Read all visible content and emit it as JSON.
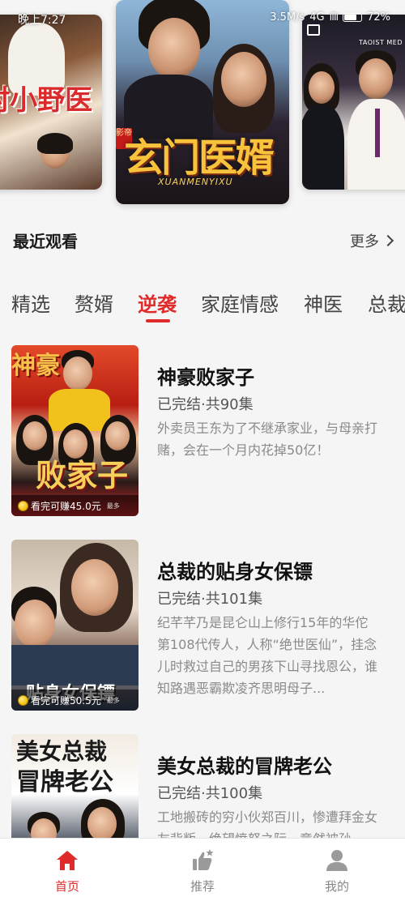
{
  "status_bar": {
    "time": "晚上7:27",
    "speed": "3.5M/s",
    "network": "4G",
    "signal": "ıllı",
    "battery": "72%"
  },
  "banner": {
    "left_title": "村小野医",
    "center_title": "玄门医婿",
    "center_subtitle": "XUANMENYIXU",
    "center_seal": "影帝",
    "right_watermark": "TAOIST MED"
  },
  "recent": {
    "title": "最近观看",
    "more_label": "更多"
  },
  "tabs": [
    "精选",
    "赘婿",
    "逆袭",
    "家庭情感",
    "神医",
    "总裁"
  ],
  "active_tab": "逆袭",
  "dramas": [
    {
      "title": "神豪败家子",
      "status": "已完结·共90集",
      "description": "外卖员王东为了不继承家业，与母亲打赌，会在一个月内花掉50亿！",
      "earn": "看完可赚45.0元",
      "earn_max": "最多",
      "poster_text": "败家子",
      "poster_top": "神豪"
    },
    {
      "title": "总裁的贴身女保镖",
      "status": "已完结·共101集",
      "description": "纪芊芊乃是昆仑山上修行15年的华佗第108代传人，人称“绝世医仙”，挂念儿时救过自己的男孩下山寻找恩公，谁知路遇恶霸欺凌齐思明母子...",
      "earn": "看完可赚50.5元",
      "earn_max": "最多",
      "poster_text": "贴身女保镖"
    },
    {
      "title": "美女总裁的冒牌老公",
      "status": "已完结·共100集",
      "description": "工地搬砖的穷小伙郑百川，惨遭拜金女友背叛，绝望愤怒之际，竟然被孙",
      "poster_text": "美女总裁",
      "poster_text2": "冒牌老公"
    }
  ],
  "nav": {
    "home": "首页",
    "recommend": "推荐",
    "mine": "我的"
  },
  "colors": {
    "accent": "#e02b2b",
    "background": "#f5f5f5"
  }
}
